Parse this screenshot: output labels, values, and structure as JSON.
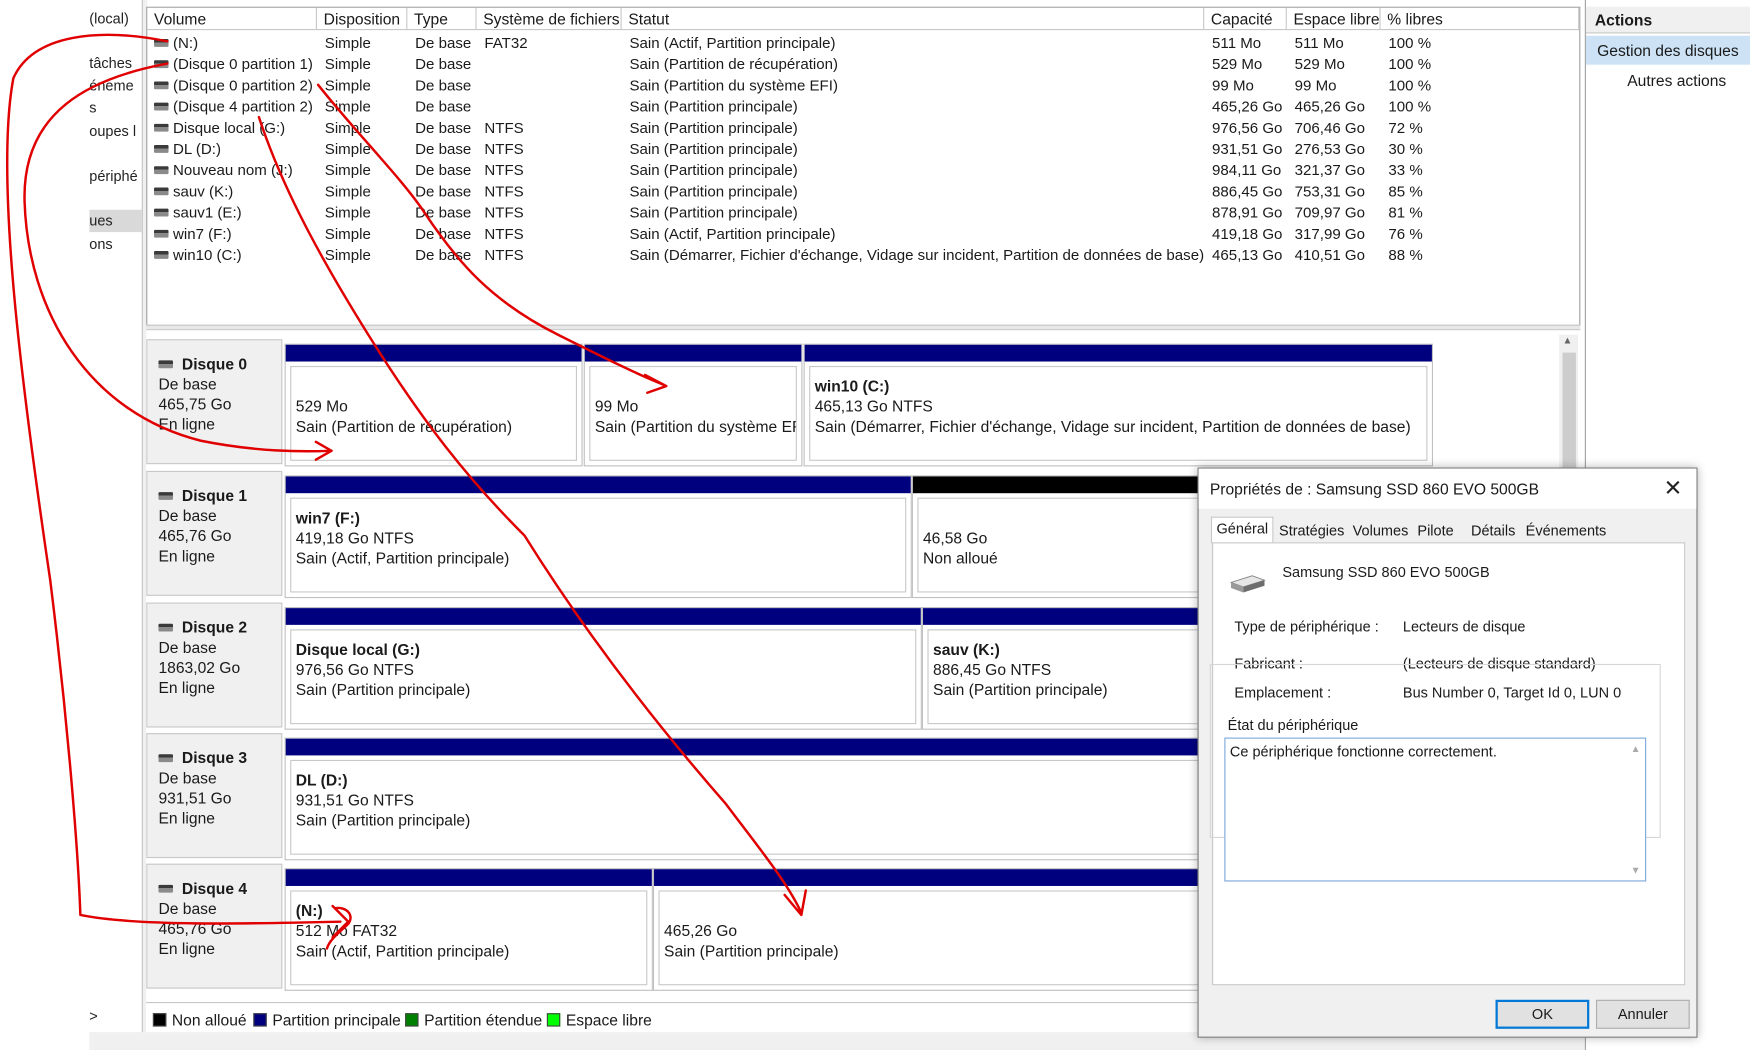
{
  "left_nav": {
    "items": [
      "(local)",
      "tâches",
      "éneme",
      "s",
      "oupes l",
      "périphé",
      "ues",
      "ons"
    ],
    "expand_arrow": ">"
  },
  "volume_table": {
    "headers": [
      "Volume",
      "Disposition",
      "Type",
      "Système de fichiers",
      "Statut",
      "Capacité",
      "Espace libre",
      "% libres"
    ],
    "rows": [
      {
        "volume": "(N:)",
        "disposition": "Simple",
        "type": "De base",
        "fs": "FAT32",
        "status": "Sain (Actif, Partition principale)",
        "capacity": "511 Mo",
        "free": "511 Mo",
        "pct": "100 %"
      },
      {
        "volume": "(Disque 0 partition 1)",
        "disposition": "Simple",
        "type": "De base",
        "fs": "",
        "status": "Sain (Partition de récupération)",
        "capacity": "529 Mo",
        "free": "529 Mo",
        "pct": "100 %"
      },
      {
        "volume": "(Disque 0 partition 2)",
        "disposition": "Simple",
        "type": "De base",
        "fs": "",
        "status": "Sain (Partition du système EFI)",
        "capacity": "99 Mo",
        "free": "99 Mo",
        "pct": "100 %"
      },
      {
        "volume": "(Disque 4 partition 2)",
        "disposition": "Simple",
        "type": "De base",
        "fs": "",
        "status": "Sain (Partition principale)",
        "capacity": "465,26 Go",
        "free": "465,26 Go",
        "pct": "100 %"
      },
      {
        "volume": "Disque local (G:)",
        "disposition": "Simple",
        "type": "De base",
        "fs": "NTFS",
        "status": "Sain (Partition principale)",
        "capacity": "976,56 Go",
        "free": "706,46 Go",
        "pct": "72 %"
      },
      {
        "volume": "DL (D:)",
        "disposition": "Simple",
        "type": "De base",
        "fs": "NTFS",
        "status": "Sain (Partition principale)",
        "capacity": "931,51 Go",
        "free": "276,53 Go",
        "pct": "30 %"
      },
      {
        "volume": "Nouveau nom (J:)",
        "disposition": "Simple",
        "type": "De base",
        "fs": "NTFS",
        "status": "Sain (Partition principale)",
        "capacity": "984,11 Go",
        "free": "321,37 Go",
        "pct": "33 %"
      },
      {
        "volume": "sauv (K:)",
        "disposition": "Simple",
        "type": "De base",
        "fs": "NTFS",
        "status": "Sain (Partition principale)",
        "capacity": "886,45 Go",
        "free": "753,31 Go",
        "pct": "85 %"
      },
      {
        "volume": "sauv1 (E:)",
        "disposition": "Simple",
        "type": "De base",
        "fs": "NTFS",
        "status": "Sain (Partition principale)",
        "capacity": "878,91 Go",
        "free": "709,97 Go",
        "pct": "81 %"
      },
      {
        "volume": "win7 (F:)",
        "disposition": "Simple",
        "type": "De base",
        "fs": "NTFS",
        "status": "Sain (Actif, Partition principale)",
        "capacity": "419,18 Go",
        "free": "317,99 Go",
        "pct": "76 %"
      },
      {
        "volume": "win10 (C:)",
        "disposition": "Simple",
        "type": "De base",
        "fs": "NTFS",
        "status": "Sain (Démarrer, Fichier d'échange, Vidage sur incident, Partition de données de base)",
        "capacity": "465,13 Go",
        "free": "410,51 Go",
        "pct": "88 %"
      }
    ]
  },
  "disks": [
    {
      "name": "Disque 0",
      "type": "De base",
      "size": "465,75 Go",
      "state": "En ligne",
      "partitions": [
        {
          "title": "",
          "line1": "529 Mo",
          "line2": "Sain (Partition de récupération)",
          "bar": "primary"
        },
        {
          "title": "",
          "line1": "99 Mo",
          "line2": "Sain (Partition du système EFI)",
          "bar": "primary"
        },
        {
          "title": "win10  (C:)",
          "line1": "465,13 Go NTFS",
          "line2": "Sain (Démarrer, Fichier d'échange, Vidage sur incident, Partition de données de base)",
          "bar": "primary"
        }
      ]
    },
    {
      "name": "Disque 1",
      "type": "De base",
      "size": "465,76 Go",
      "state": "En ligne",
      "partitions": [
        {
          "title": "win7  (F:)",
          "line1": "419,18 Go NTFS",
          "line2": "Sain (Actif, Partition principale)",
          "bar": "primary"
        },
        {
          "title": "",
          "line1": "46,58 Go",
          "line2": "Non alloué",
          "bar": "unallocated"
        }
      ]
    },
    {
      "name": "Disque 2",
      "type": "De base",
      "size": "1863,02 Go",
      "state": "En ligne",
      "partitions": [
        {
          "title": "Disque local  (G:)",
          "line1": "976,56 Go NTFS",
          "line2": "Sain (Partition principale)",
          "bar": "primary"
        },
        {
          "title": "sauv  (K:)",
          "line1": "886,45 Go NTFS",
          "line2": "Sain (Partition principale)",
          "bar": "primary"
        }
      ]
    },
    {
      "name": "Disque 3",
      "type": "De base",
      "size": "931,51 Go",
      "state": "En ligne",
      "partitions": [
        {
          "title": "DL  (D:)",
          "line1": "931,51 Go NTFS",
          "line2": "Sain (Partition principale)",
          "bar": "primary"
        }
      ]
    },
    {
      "name": "Disque 4",
      "type": "De base",
      "size": "465,76 Go",
      "state": "En ligne",
      "partitions": [
        {
          "title": "(N:)",
          "line1": "512 Mo FAT32",
          "line2": "Sain (Actif, Partition principale)",
          "bar": "primary"
        },
        {
          "title": "",
          "line1": "465,26 Go",
          "line2": "Sain (Partition principale)",
          "bar": "primary"
        }
      ]
    }
  ],
  "legend": [
    {
      "label": "Non alloué",
      "color": "#000000"
    },
    {
      "label": "Partition principale",
      "color": "#00007f"
    },
    {
      "label": "Partition étendue",
      "color": "#008000"
    },
    {
      "label": "Espace libre",
      "color": "#00ff00"
    }
  ],
  "actions": {
    "title": "Actions",
    "selected": "Gestion des disques",
    "more": "Autres actions"
  },
  "dialog": {
    "title": "Propriétés de : Samsung SSD 860 EVO 500GB",
    "close": "✕",
    "tabs": [
      "Général",
      "Stratégies",
      "Volumes",
      "Pilote",
      "Détails",
      "Événements"
    ],
    "active_tab": "Général",
    "device_name": "Samsung SSD 860 EVO 500GB",
    "fields": [
      {
        "label": "Type de périphérique :",
        "value": "Lecteurs de disque"
      },
      {
        "label": "Fabricant :",
        "value": "(Lecteurs de disque standard)"
      },
      {
        "label": "Emplacement :",
        "value": "Bus Number 0, Target Id 0, LUN 0"
      }
    ],
    "state_legend": "État du périphérique",
    "state_text": "Ce périphérique fonctionne correctement.",
    "ok": "OK",
    "cancel": "Annuler"
  },
  "colors": {
    "primary_partition": "#00007f",
    "unallocated": "#000000",
    "annotation": "#e00000",
    "selection": "#cde3f5"
  }
}
